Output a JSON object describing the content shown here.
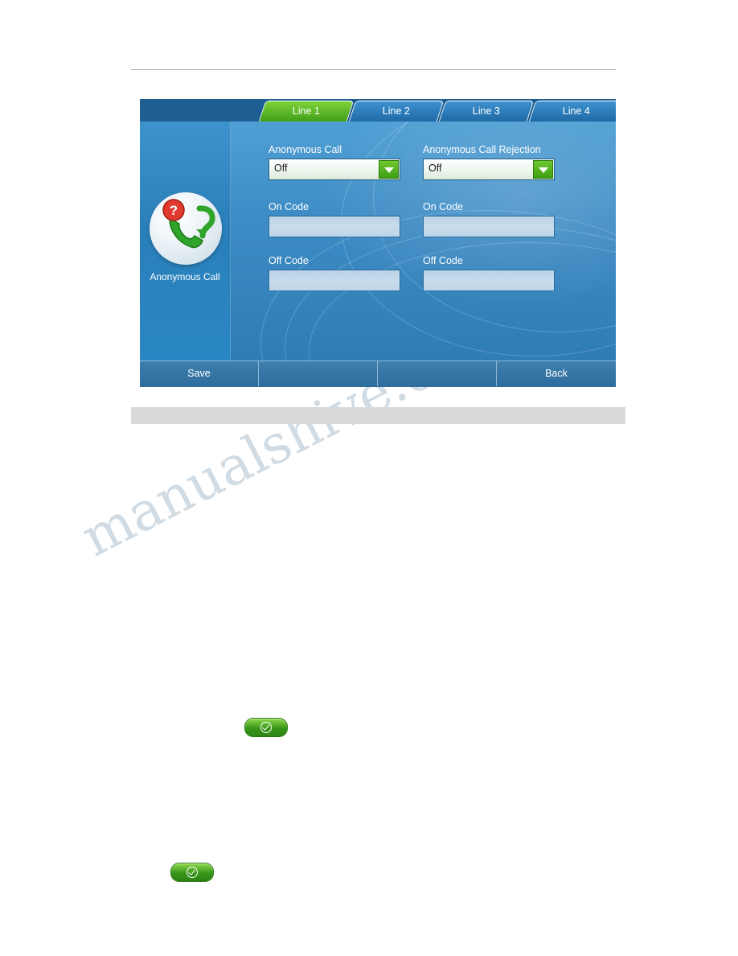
{
  "phone_screen": {
    "tabs": [
      {
        "label": "Line 1",
        "active": true
      },
      {
        "label": "Line 2",
        "active": false
      },
      {
        "label": "Line 3",
        "active": false
      },
      {
        "label": "Line 4",
        "active": false
      }
    ],
    "left_panel": {
      "icon": "anonymous-call-icon",
      "caption": "Anonymous Call"
    },
    "fields": {
      "anonymous_call": {
        "label": "Anonymous Call",
        "value": "Off"
      },
      "anonymous_call_on_code": {
        "label": "On Code",
        "value": ""
      },
      "anonymous_call_off_code": {
        "label": "Off Code",
        "value": ""
      },
      "anonymous_call_rejection": {
        "label": "Anonymous Call Rejection",
        "value": "Off"
      },
      "rejection_on_code": {
        "label": "On Code",
        "value": ""
      },
      "rejection_off_code": {
        "label": "Off Code",
        "value": ""
      }
    },
    "softkeys": [
      {
        "label": "Save"
      },
      {
        "label": ""
      },
      {
        "label": ""
      },
      {
        "label": "Back"
      }
    ]
  },
  "page": {
    "watermark": "manualshive.com",
    "caption_bar": ""
  },
  "inline_buttons": [
    {
      "name": "ok-pill-1",
      "icon": "check-circle-icon"
    },
    {
      "name": "ok-pill-2",
      "icon": "check-circle-icon"
    }
  ],
  "colors": {
    "tab_active": "#58b52a",
    "screen_blue": "#3e8cc5",
    "softkey_bar": "#336f9f",
    "pill_green": "#37951a"
  }
}
